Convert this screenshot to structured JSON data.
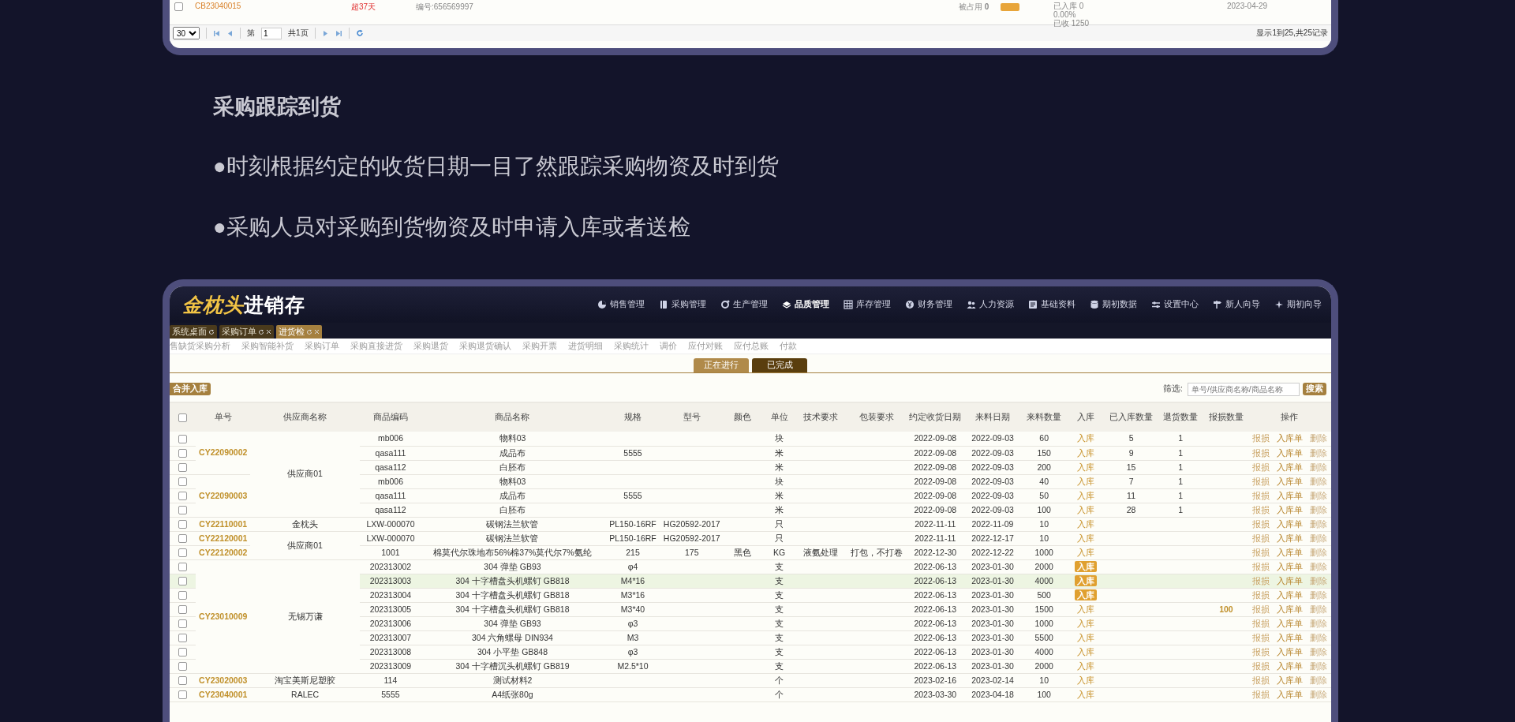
{
  "top_list": {
    "rows": [
      {
        "checked": false,
        "order_no": "CB23040015",
        "overdue": "超37天",
        "code": "编号:656569997",
        "occupied": "被占用 **0**",
        "stock_lines": [
          "已入库 0",
          "0.00%",
          "已收 1250"
        ],
        "date": "2023-04-29"
      }
    ],
    "pager": {
      "page_size": "30",
      "page_prefix": "第",
      "page": "1",
      "page_total": "共1页",
      "summary": "显示1到25,共25记录"
    }
  },
  "section": {
    "title": "采购跟踪到货",
    "bullets": [
      "●时刻根据约定的收货日期一目了然跟踪采购物资及时到货",
      "●采购人员对采购到货物资及时申请入库或者送检"
    ]
  },
  "app": {
    "logo": {
      "gold": "金枕头",
      "white": "进销存"
    },
    "nav": [
      {
        "label": "销售管理",
        "selected": false
      },
      {
        "label": "采购管理",
        "selected": false
      },
      {
        "label": "生产管理",
        "selected": false
      },
      {
        "label": "品质管理",
        "selected": true
      },
      {
        "label": "库存管理",
        "selected": false
      },
      {
        "label": "财务管理",
        "selected": false
      },
      {
        "label": "人力资源",
        "selected": false
      },
      {
        "label": "基础资料",
        "selected": false
      },
      {
        "label": "期初数据",
        "selected": false
      },
      {
        "label": "设置中心",
        "selected": false
      },
      {
        "label": "新人向导",
        "selected": false
      },
      {
        "label": "期初向导",
        "selected": false
      }
    ],
    "tabs": [
      {
        "label": "系统桌面",
        "selected": false,
        "closable": false
      },
      {
        "label": "采购订单",
        "selected": false,
        "closable": true
      },
      {
        "label": "进货检",
        "selected": true,
        "closable": true
      }
    ],
    "menu": [
      "售缺货采购分析",
      "采购智能补货",
      "采购订单",
      "采购直接进货",
      "采购退货",
      "采购退货确认",
      "采购开票",
      "进货明细",
      "采购统计",
      "调价",
      "应付对账",
      "应付总账",
      "付款"
    ],
    "status_tabs": [
      {
        "label": "正在进行",
        "selected": true
      },
      {
        "label": "已完成",
        "selected": false
      }
    ],
    "merge_button": "合并入库",
    "filter": {
      "label": "筛选:",
      "placeholder": "单号/供应商名称/商品名称",
      "button": "搜索"
    },
    "table": {
      "select_all_checked": false,
      "columns": [
        "单号",
        "供应商名称",
        "商品编码",
        "商品名称",
        "规格",
        "型号",
        "颜色",
        "单位",
        "技术要求",
        "包装要求",
        "约定收货日期",
        "来料日期",
        "来料数量",
        "入库",
        "已入库数量",
        "退货数量",
        "报损数量",
        "操作"
      ],
      "groups": [
        {
          "supplier": "供应商01",
          "orders": [
            {
              "order_no": "CY22090002",
              "items": [
                {
                  "checked": false,
                  "selected": false,
                  "code": "mb006",
                  "name": "物料03",
                  "unit": "块",
                  "due_date": "2022-09-08",
                  "arrival_date": "2022-09-03",
                  "qty": "60",
                  "stock_in": "入库",
                  "highlighted": false,
                  "stored": "5",
                  "returned": "1",
                  "actions": [
                    "报损",
                    "入库单",
                    "删除"
                  ]
                },
                {
                  "checked": false,
                  "selected": false,
                  "code": "qasa111",
                  "name": "成品布",
                  "spec": "5555",
                  "unit": "米",
                  "due_date": "2022-09-08",
                  "arrival_date": "2022-09-03",
                  "qty": "150",
                  "stock_in": "入库",
                  "highlighted": false,
                  "stored": "9",
                  "returned": "1",
                  "actions": [
                    "报损",
                    "入库单",
                    "删除"
                  ]
                },
                {
                  "checked": false,
                  "selected": false,
                  "code": "qasa112",
                  "name": "白胚布",
                  "unit": "米",
                  "due_date": "2022-09-08",
                  "arrival_date": "2022-09-03",
                  "qty": "200",
                  "stock_in": "入库",
                  "highlighted": false,
                  "stored": "15",
                  "returned": "1",
                  "actions": [
                    "报损",
                    "入库单",
                    "删除"
                  ]
                }
              ]
            },
            {
              "order_no": "CY22090003",
              "items": [
                {
                  "checked": false,
                  "selected": false,
                  "code": "mb006",
                  "name": "物料03",
                  "unit": "块",
                  "due_date": "2022-09-08",
                  "arrival_date": "2022-09-03",
                  "qty": "40",
                  "stock_in": "入库",
                  "highlighted": false,
                  "stored": "7",
                  "returned": "1",
                  "actions": [
                    "报损",
                    "入库单",
                    "删除"
                  ]
                },
                {
                  "checked": false,
                  "selected": false,
                  "code": "qasa111",
                  "name": "成品布",
                  "spec": "5555",
                  "unit": "米",
                  "due_date": "2022-09-08",
                  "arrival_date": "2022-09-03",
                  "qty": "50",
                  "stock_in": "入库",
                  "highlighted": false,
                  "stored": "11",
                  "returned": "1",
                  "actions": [
                    "报损",
                    "入库单",
                    "删除"
                  ]
                },
                {
                  "checked": false,
                  "selected": false,
                  "code": "qasa112",
                  "name": "白胚布",
                  "unit": "米",
                  "due_date": "2022-09-08",
                  "arrival_date": "2022-09-03",
                  "qty": "100",
                  "stock_in": "入库",
                  "highlighted": false,
                  "stored": "28",
                  "returned": "1",
                  "actions": [
                    "报损",
                    "入库单",
                    "删除"
                  ]
                }
              ]
            }
          ]
        },
        {
          "supplier": "金枕头",
          "orders": [
            {
              "order_no": "CY22110001",
              "items": [
                {
                  "checked": false,
                  "selected": false,
                  "code": "LXW-000070",
                  "name": "碳钢法兰软管",
                  "spec": "PL150-16RF",
                  "model": "HG20592-2017",
                  "unit": "只",
                  "due_date": "2022-11-11",
                  "arrival_date": "2022-11-09",
                  "qty": "10",
                  "stock_in": "入库",
                  "highlighted": false,
                  "actions": [
                    "报损",
                    "入库单",
                    "删除"
                  ]
                }
              ]
            }
          ]
        },
        {
          "supplier": "供应商01",
          "orders": [
            {
              "order_no": "CY22120001",
              "items": [
                {
                  "checked": false,
                  "selected": false,
                  "code": "LXW-000070",
                  "name": "碳钢法兰软管",
                  "spec": "PL150-16RF",
                  "model": "HG20592-2017",
                  "unit": "只",
                  "due_date": "2022-11-11",
                  "arrival_date": "2022-12-17",
                  "qty": "10",
                  "stock_in": "入库",
                  "highlighted": false,
                  "actions": [
                    "报损",
                    "入库单",
                    "删除"
                  ]
                }
              ]
            },
            {
              "order_no": "CY22120002",
              "items": [
                {
                  "checked": false,
                  "selected": false,
                  "code": "1001",
                  "name": "棉莫代尔珠地布56%棉37%莫代尔7%氨纶",
                  "spec": "215",
                  "model": "175",
                  "color_name": "黑色",
                  "unit": "KG",
                  "tech": "液氨处理",
                  "packing": "打包，不打卷",
                  "due_date": "2022-12-30",
                  "arrival_date": "2022-12-22",
                  "qty": "1000",
                  "stock_in": "入库",
                  "highlighted": false,
                  "actions": [
                    "报损",
                    "入库单",
                    "删除"
                  ]
                }
              ]
            }
          ]
        },
        {
          "supplier": "无锡万谦",
          "orders": [
            {
              "order_no": "CY23010009",
              "items": [
                {
                  "checked": false,
                  "selected": false,
                  "code": "202313002",
                  "name": "304 弹垫 GB93",
                  "spec": "φ4",
                  "unit": "支",
                  "due_date": "2022-06-13",
                  "arrival_date": "2023-01-30",
                  "qty": "2000",
                  "stock_in": "入库",
                  "highlighted": true,
                  "actions": [
                    "报损",
                    "入库单",
                    "删除"
                  ]
                },
                {
                  "checked": false,
                  "selected": true,
                  "code": "202313003",
                  "name": "304 十字槽盘头机螺钉 GB818",
                  "spec": "M4*16",
                  "unit": "支",
                  "due_date": "2022-06-13",
                  "arrival_date": "2023-01-30",
                  "qty": "4000",
                  "stock_in": "入库",
                  "highlighted": true,
                  "actions": [
                    "报损",
                    "入库单",
                    "删除"
                  ]
                },
                {
                  "checked": false,
                  "selected": false,
                  "code": "202313004",
                  "name": "304 十字槽盘头机螺钉 GB818",
                  "spec": "M3*16",
                  "unit": "支",
                  "due_date": "2022-06-13",
                  "arrival_date": "2023-01-30",
                  "qty": "500",
                  "stock_in": "入库",
                  "highlighted": true,
                  "actions": [
                    "报损",
                    "入库单",
                    "删除"
                  ]
                },
                {
                  "checked": false,
                  "selected": false,
                  "code": "202313005",
                  "name": "304 十字槽盘头机螺钉 GB818",
                  "spec": "M3*40",
                  "unit": "支",
                  "due_date": "2022-06-13",
                  "arrival_date": "2023-01-30",
                  "qty": "1500",
                  "stock_in": "入库",
                  "highlighted": false,
                  "damaged": "100",
                  "actions": [
                    "报损",
                    "入库单",
                    "删除"
                  ]
                },
                {
                  "checked": false,
                  "selected": false,
                  "code": "202313006",
                  "name": "304 弹垫 GB93",
                  "spec": "φ3",
                  "unit": "支",
                  "due_date": "2022-06-13",
                  "arrival_date": "2023-01-30",
                  "qty": "1000",
                  "stock_in": "入库",
                  "highlighted": false,
                  "actions": [
                    "报损",
                    "入库单",
                    "删除"
                  ]
                },
                {
                  "checked": false,
                  "selected": false,
                  "code": "202313007",
                  "name": "304 六角螺母 DIN934",
                  "spec": "M3",
                  "unit": "支",
                  "due_date": "2022-06-13",
                  "arrival_date": "2023-01-30",
                  "qty": "5500",
                  "stock_in": "入库",
                  "highlighted": false,
                  "actions": [
                    "报损",
                    "入库单",
                    "删除"
                  ]
                },
                {
                  "checked": false,
                  "selected": false,
                  "code": "202313008",
                  "name": "304 小平垫 GB848",
                  "spec": "φ3",
                  "unit": "支",
                  "due_date": "2022-06-13",
                  "arrival_date": "2023-01-30",
                  "qty": "4000",
                  "stock_in": "入库",
                  "highlighted": false,
                  "actions": [
                    "报损",
                    "入库单",
                    "删除"
                  ]
                },
                {
                  "checked": false,
                  "selected": false,
                  "code": "202313009",
                  "name": "304 十字槽沉头机螺钉 GB819",
                  "spec": "M2.5*10",
                  "unit": "支",
                  "due_date": "2022-06-13",
                  "arrival_date": "2023-01-30",
                  "qty": "2000",
                  "stock_in": "入库",
                  "highlighted": false,
                  "actions": [
                    "报损",
                    "入库单",
                    "删除"
                  ]
                }
              ]
            }
          ]
        },
        {
          "supplier": "淘宝美斯尼塑胶",
          "orders": [
            {
              "order_no": "CY23020003",
              "items": [
                {
                  "checked": false,
                  "selected": false,
                  "code": "114",
                  "name": "测试材料2",
                  "unit": "个",
                  "due_date": "2023-02-16",
                  "arrival_date": "2023-02-14",
                  "qty": "10",
                  "stock_in": "入库",
                  "highlighted": false,
                  "actions": [
                    "报损",
                    "入库单",
                    "删除"
                  ]
                }
              ]
            }
          ]
        },
        {
          "supplier": "RALEC",
          "orders": [
            {
              "order_no": "CY23040001",
              "items": [
                {
                  "checked": false,
                  "selected": false,
                  "code": "5555",
                  "name": "A4纸张80g",
                  "unit": "个",
                  "due_date": "2023-03-30",
                  "arrival_date": "2023-04-18",
                  "qty": "100",
                  "stock_in": "入库",
                  "highlighted": false,
                  "actions": [
                    "报损",
                    "入库单",
                    "删除"
                  ]
                }
              ]
            }
          ]
        }
      ]
    }
  }
}
